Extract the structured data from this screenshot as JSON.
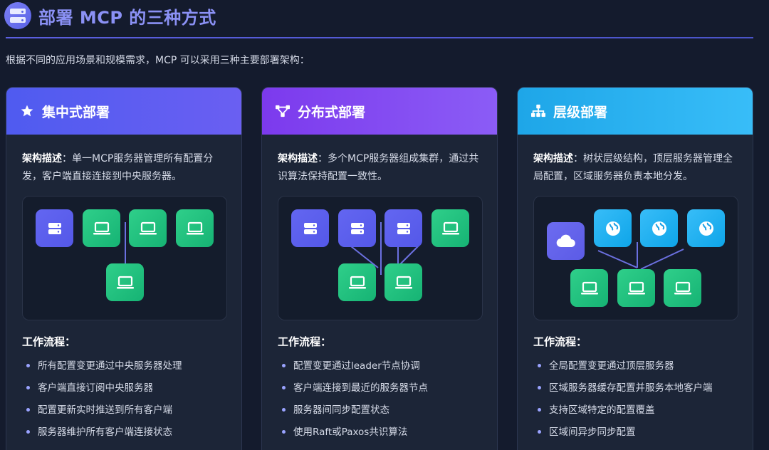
{
  "header": {
    "title": "部署 MCP 的三种方式",
    "icon": "server-stack-icon",
    "accent": "#8b91f5"
  },
  "intro": "根据不同的应用场景和规模需求，MCP 可以采用三种主要部署架构：",
  "cards": [
    {
      "title": "集中式部署",
      "icon": "star-icon",
      "color": "#5a5ff0",
      "desc_label": "架构描述",
      "desc_text": "：单一MCP服务器管理所有配置分发，客户端直接连接到中央服务器。",
      "flow_title": "工作流程：",
      "flow": [
        "所有配置变更通过中央服务器处理",
        "客户端直接订阅中央服务器",
        "配置更新实时推送到所有客户端",
        "服务器维护所有客户端连接状态"
      ]
    },
    {
      "title": "分布式部署",
      "icon": "network-nodes-icon",
      "color": "#8246ee",
      "desc_label": "架构描述",
      "desc_text": "：多个MCP服务器组成集群，通过共识算法保持配置一致性。",
      "flow_title": "工作流程：",
      "flow": [
        "配置变更通过leader节点协调",
        "客户端连接到最近的服务器节点",
        "服务器间同步配置状态",
        "使用Raft或Paxos共识算法"
      ]
    },
    {
      "title": "层级部署",
      "icon": "hierarchy-icon",
      "color": "#2aaff0",
      "desc_label": "架构描述",
      "desc_text": "：树状层级结构，顶层服务器管理全局配置，区域服务器负责本地分发。",
      "flow_title": "工作流程：",
      "flow": [
        "全局配置变更通过顶层服务器",
        "区域服务器缓存配置并服务本地客户端",
        "支持区域特定的配置覆盖",
        "区域间异步同步配置"
      ]
    }
  ]
}
